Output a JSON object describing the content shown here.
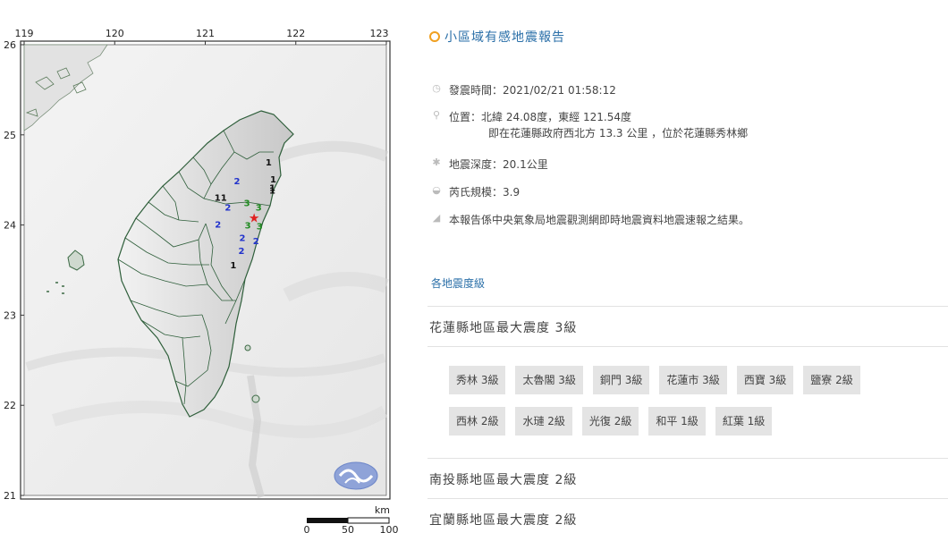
{
  "map": {
    "lon_ticks": [
      "119",
      "120",
      "121",
      "122",
      "123"
    ],
    "lat_ticks": [
      "26",
      "25",
      "24",
      "23",
      "22",
      "21"
    ],
    "epicenter": {
      "lat": 24.08,
      "lon": 121.54
    },
    "intensity_markers": [
      {
        "value": "1",
        "lat": 24.66,
        "lon": 121.7
      },
      {
        "value": "1",
        "lat": 24.47,
        "lon": 121.75
      },
      {
        "value": "1",
        "lat": 24.38,
        "lon": 121.74
      },
      {
        "value": "1",
        "lat": 24.35,
        "lon": 121.74
      },
      {
        "value": "2",
        "lat": 24.45,
        "lon": 121.35
      },
      {
        "value": "11",
        "lat": 24.27,
        "lon": 121.17
      },
      {
        "value": "2",
        "lat": 24.16,
        "lon": 121.25
      },
      {
        "value": "3",
        "lat": 24.21,
        "lon": 121.46
      },
      {
        "value": "3",
        "lat": 24.16,
        "lon": 121.59
      },
      {
        "value": "2",
        "lat": 23.97,
        "lon": 121.14
      },
      {
        "value": "3",
        "lat": 23.96,
        "lon": 121.47
      },
      {
        "value": "3",
        "lat": 23.95,
        "lon": 121.6
      },
      {
        "value": "2",
        "lat": 23.82,
        "lon": 121.41
      },
      {
        "value": "2",
        "lat": 23.79,
        "lon": 121.56
      },
      {
        "value": "2",
        "lat": 23.68,
        "lon": 121.4
      },
      {
        "value": "1",
        "lat": 23.52,
        "lon": 121.31
      }
    ],
    "scale": {
      "unit": "km",
      "labels": [
        "0",
        "50",
        "100"
      ]
    },
    "colors": {
      "level1": "#111111",
      "level2": "#2233cc",
      "level3": "#1f8a1f",
      "epicenter": "#e02020",
      "border": "#2e5e3a"
    }
  },
  "report": {
    "title": "小區域有感地震報告",
    "time": "發震時間：2021/02/21 01:58:12",
    "location": "位置：北緯 24.08度，東經 121.54度",
    "location_sub": "即在花蓮縣政府西北方 13.3 公里 ，位於花蓮縣秀林鄉",
    "depth": "地震深度：20.1公里",
    "magnitude": "芮氏規模：3.9",
    "note": "本報告係中央氣象局地震觀測網即時地震資料地震速報之結果。",
    "section_label": "各地震度級",
    "counties": [
      {
        "header": "花蓮縣地區最大震度 3級"
      },
      {
        "header": "南投縣地區最大震度 2級"
      },
      {
        "header": "宜蘭縣地區最大震度 2級"
      }
    ],
    "stations_row1": [
      "秀林 3級",
      "太魯閣 3級",
      "銅門 3級",
      "花蓮市 3級",
      "西寶 3級",
      "鹽寮 2級"
    ],
    "stations_row2": [
      "西林 2級",
      "水璉 2級",
      "光復 2級",
      "和平 1級",
      "紅葉 1級"
    ]
  }
}
